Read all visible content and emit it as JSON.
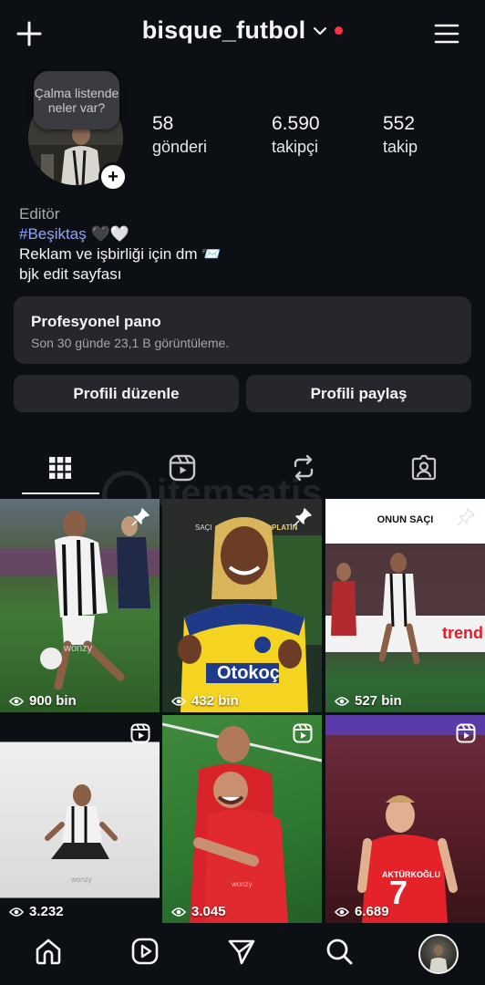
{
  "header": {
    "username": "bisque_futbol"
  },
  "profile": {
    "note": "Çalma listende neler var?",
    "stats": [
      {
        "value": "58",
        "label": "gönderi"
      },
      {
        "value": "6.590",
        "label": "takipçi"
      },
      {
        "value": "552",
        "label": "takip"
      }
    ],
    "category": "Editör",
    "hashtag": "#Beşiktaş",
    "hashtag_emoji": "🖤🤍",
    "bio_line1": "Reklam ve işbirliği için dm",
    "bio_line1_emoji": "📨",
    "bio_line2": "bjk edit sayfası"
  },
  "pro_panel": {
    "title": "Profesyonel pano",
    "subtitle": "Son 30 günde 23,1 B görüntüleme."
  },
  "buttons": {
    "edit": "Profili düzenle",
    "share": "Profili paylaş"
  },
  "tabs": [
    {
      "icon": "grid-icon",
      "active": true
    },
    {
      "icon": "reels-icon",
      "active": false
    },
    {
      "icon": "repost-icon",
      "active": false
    },
    {
      "icon": "tagged-icon",
      "active": false
    }
  ],
  "watermark": "itemsatis",
  "posts": [
    {
      "views": "900 bin",
      "badge": "pin-icon",
      "overlay_text": "wonzy",
      "colors": [
        "#3f6b3a",
        "#1f3b1c"
      ]
    },
    {
      "views": "432 bin",
      "badge": "pin-icon",
      "overlay_text": "Otokoç",
      "top_left": "SAÇI",
      "top_right": "PLATİN",
      "colors": [
        "#2a2a2a",
        "#12201a"
      ]
    },
    {
      "views": "527 bin",
      "badge": "pin-icon",
      "overlay_text": "ONUN SAÇI",
      "brand": "trend",
      "colors": [
        "#1f6e2d",
        "#3b2a2a"
      ]
    },
    {
      "views": "3.232",
      "badge": "reels-icon",
      "overlay_text": "wonzy",
      "colors": [
        "#e6e6e6",
        "#cfcfcf"
      ]
    },
    {
      "views": "3.045",
      "badge": "reels-icon",
      "overlay_text": "wonzy",
      "colors": [
        "#2f7a32",
        "#b4282e"
      ]
    },
    {
      "views": "6.689",
      "badge": "reels-icon",
      "overlay_text": "AKTÜRKOĞLU",
      "jersey": "7",
      "colors": [
        "#7a1f2a",
        "#3a0f14"
      ]
    }
  ],
  "bottom_nav": [
    {
      "icon": "home-icon"
    },
    {
      "icon": "reels-icon"
    },
    {
      "icon": "send-icon"
    },
    {
      "icon": "search-icon"
    },
    {
      "icon": "profile-avatar"
    }
  ]
}
